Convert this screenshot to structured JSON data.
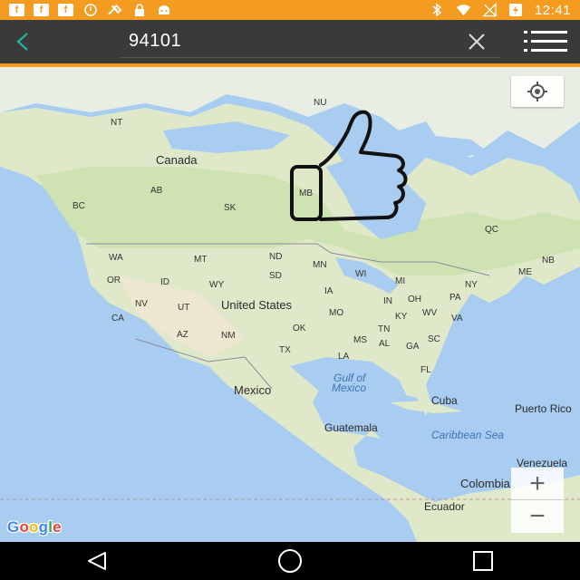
{
  "status_bar": {
    "time": "12:41",
    "left_icons": [
      "facebook-icon",
      "facebook-icon",
      "facebook-icon",
      "alarm-icon",
      "tools-icon",
      "lock-icon",
      "android-icon"
    ],
    "right_icons": [
      "bluetooth-icon",
      "wifi-icon",
      "no-sim-icon",
      "battery-charging-icon"
    ],
    "color": "#f39c1f"
  },
  "app_bar": {
    "search_value": "94101",
    "accent": "#1eb5a0"
  },
  "map": {
    "labels": {
      "nu": "NU",
      "nt": "NT",
      "canada": "Canada",
      "ab": "AB",
      "bc": "BC",
      "sk": "SK",
      "mb": "MB",
      "qc": "QC",
      "nb": "NB",
      "me": "ME",
      "wa": "WA",
      "mt": "MT",
      "nd": "ND",
      "mn": "MN",
      "wi": "WI",
      "mi": "MI",
      "or": "OR",
      "id": "ID",
      "wy": "WY",
      "sd": "SD",
      "ny": "NY",
      "pa": "PA",
      "nv": "NV",
      "ut": "UT",
      "us": "United States",
      "ia": "IA",
      "in": "IN",
      "oh": "OH",
      "ca": "CA",
      "mo": "MO",
      "ky": "KY",
      "wv": "WV",
      "va": "VA",
      "az": "AZ",
      "nm": "NM",
      "ok": "OK",
      "tn": "TN",
      "tx": "TX",
      "ms": "MS",
      "al": "AL",
      "ga": "GA",
      "sc": "SC",
      "la": "LA",
      "fl": "FL",
      "gulf1": "Gulf of",
      "gulf2": "Mexico",
      "mexico": "Mexico",
      "cuba": "Cuba",
      "puerto": "Puerto Rico",
      "guatemala": "Guatemala",
      "caribbean": "Caribbean Sea",
      "venezuela": "Venezuela",
      "colombia": "Colombia",
      "ecuador": "Ecuador"
    },
    "google_letters": [
      "G",
      "o",
      "o",
      "g",
      "l",
      "e"
    ],
    "google_colors": [
      "#4285f4",
      "#ea4335",
      "#fbbc05",
      "#4285f4",
      "#34a853",
      "#ea4335"
    ],
    "zoom_in": "+",
    "zoom_out": "−"
  }
}
